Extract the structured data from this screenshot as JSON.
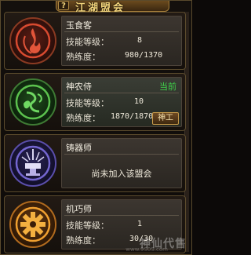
{
  "window": {
    "title": "江湖盟会",
    "help_label": "?"
  },
  "labels": {
    "skill_level": "技能等级：",
    "proficiency": "熟练度："
  },
  "guilds": [
    {
      "name": "玉食客",
      "level": "8",
      "proficiency": "980/1370",
      "emblem": "chef-flame-emblem-icon",
      "emblem_color": "#c23a2a"
    },
    {
      "name": "神农侍",
      "status": "当前",
      "level": "10",
      "proficiency": "1870/1870",
      "rank_button": "神工",
      "emblem": "herbalist-emblem-icon",
      "emblem_color": "#2f8a32"
    },
    {
      "name": "铸器师",
      "message": "尚未加入该盟会",
      "emblem": "smith-anvil-emblem-icon",
      "emblem_color": "#4a3ea0"
    },
    {
      "name": "机巧师",
      "level": "1",
      "proficiency": "30/30",
      "emblem": "mechanic-gear-emblem-icon",
      "emblem_color": "#d0891e"
    }
  ],
  "watermark": {
    "text": "神仙代售",
    "sub": "www.9S0S.com"
  }
}
